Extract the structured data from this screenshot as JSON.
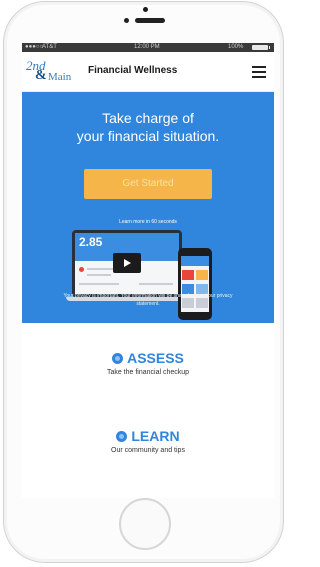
{
  "status_bar": {
    "signal": "●●●○○",
    "carrier": "AT&T",
    "time": "12:00 PM",
    "battery_pct": "100%"
  },
  "header": {
    "logo": {
      "part1": "2nd",
      "part2": "&",
      "part3": "Main"
    },
    "title": "Financial Wellness",
    "menu_icon": "hamburger-menu-icon"
  },
  "hero": {
    "title_line1": "Take charge of",
    "title_line2": "your financial situation.",
    "cta_label": "Get Started",
    "learn_link": "Learn more in 60 seconds",
    "laptop_number": "2.85",
    "privacy_text": "Your privacy is important. Your information will be shared — read our privacy statement.",
    "colors": {
      "background": "#2f86dc",
      "cta": "#f5b548"
    }
  },
  "features": [
    {
      "title": "ASSESS",
      "description": "Take the financial checkup",
      "icon": "circle-icon"
    },
    {
      "title": "LEARN",
      "description": "Our community and tips",
      "icon": "circle-icon"
    }
  ]
}
